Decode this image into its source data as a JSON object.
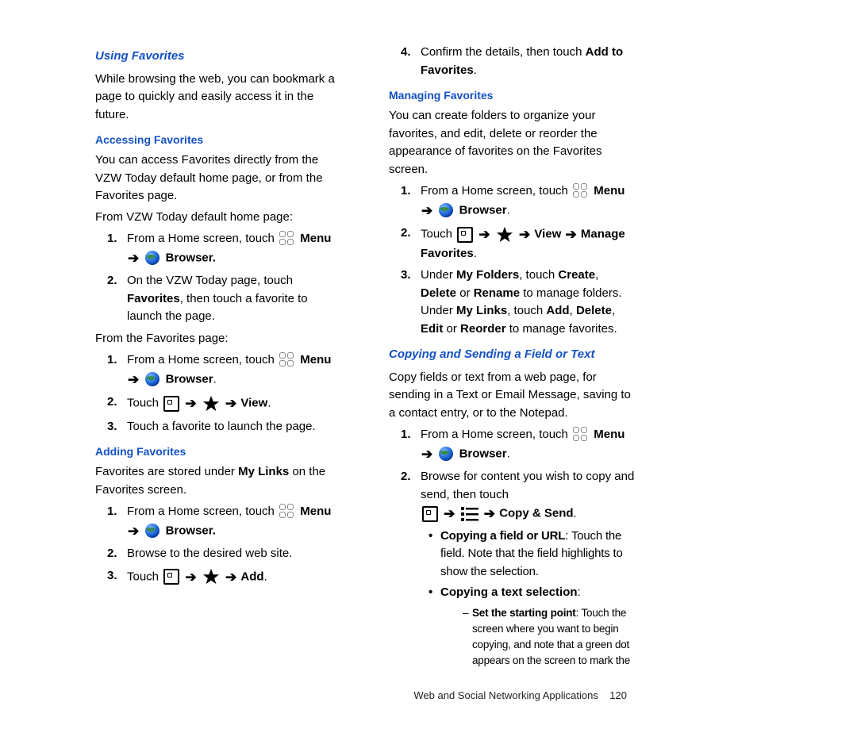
{
  "arrow": "➔",
  "left": {
    "h2_using": "Using Favorites",
    "p_intro": "While browsing the web, you can bookmark a page to quickly and easily access it in the future.",
    "h3_access": "Accessing Favorites",
    "p_access": "You can access Favorites directly from the VZW Today default home page, or from the Favorites page.",
    "p_from_vzw": "From VZW Today default home page:",
    "vzw_steps": [
      {
        "n": "1.",
        "pre": "From a Home screen, touch ",
        "menu": "Menu",
        "browser": "Browser."
      },
      {
        "n": "2.",
        "text_pre": "On the VZW Today page, touch ",
        "text_b": "Favorites",
        "text_post": ", then touch a favorite to launch the page."
      }
    ],
    "p_from_fav": "From the Favorites page:",
    "fav_steps": [
      {
        "n": "1.",
        "pre": "From a Home screen, touch ",
        "menu": "Menu",
        "browser": "Browser"
      },
      {
        "n": "2.",
        "pre": "Touch ",
        "post": " View"
      },
      {
        "n": "3.",
        "text": "Touch a favorite to launch the page."
      }
    ],
    "h3_add": "Adding Favorites",
    "p_add_pre": "Favorites are stored under ",
    "p_add_b": "My Links",
    "p_add_post": " on the Favorites screen.",
    "add_steps": [
      {
        "n": "1.",
        "pre": "From a Home screen, touch ",
        "menu": "Menu",
        "browser": "Browser."
      },
      {
        "n": "2.",
        "text": "Browse to the desired web site."
      },
      {
        "n": "3.",
        "pre": "Touch ",
        "post": " Add"
      }
    ]
  },
  "right": {
    "confirm": {
      "n": "4.",
      "pre": "Confirm the details, then touch ",
      "b": "Add to Favorites",
      "post": "."
    },
    "h3_manage": "Managing Favorites",
    "p_manage": "You can create folders to organize your favorites, and edit, delete or reorder the appearance of favorites on the Favorites screen.",
    "manage_steps": [
      {
        "n": "1.",
        "pre": "From a Home screen, touch ",
        "menu": "Menu",
        "browser": "Browser"
      },
      {
        "n": "2.",
        "pre": "Touch ",
        "mid": " View ",
        "post": " Manage Favorites"
      },
      {
        "n": "3.",
        "parts": [
          "Under ",
          "My Folders",
          ", touch ",
          "Create",
          ", ",
          "Delete",
          " or ",
          "Rename",
          " to manage folders.  Under ",
          "My Links",
          ", touch ",
          "Add",
          ", ",
          "Delete",
          ", ",
          "Edit",
          " or ",
          "Reorder",
          " to manage favorites."
        ]
      }
    ],
    "h2_copy": "Copying and Sending a Field or Text",
    "p_copy": "Copy fields or text from a web page, for sending in a Text or Email Message, saving to a contact entry, or to the Notepad.",
    "copy_steps": [
      {
        "n": "1.",
        "pre": "From a Home screen, touch ",
        "menu": "Menu",
        "browser": "Browser"
      },
      {
        "n": "2.",
        "text": "Browse for content you wish to copy and send, then touch",
        "tail": " Copy & Send"
      }
    ],
    "bullets": {
      "field_b": "Copying a field or URL",
      "field_txt": ": Touch the field. Note that the field highlights to show the selection.",
      "textsel_b": "Copying a text selection",
      "textsel_txt": ":"
    },
    "dash": {
      "b": "Set the starting point",
      "txt": ": Touch the screen where you want to begin copying, and note that a green dot appears on the screen to mark the"
    }
  },
  "footer": {
    "text": "Web and Social Networking Applications",
    "page": "120"
  }
}
